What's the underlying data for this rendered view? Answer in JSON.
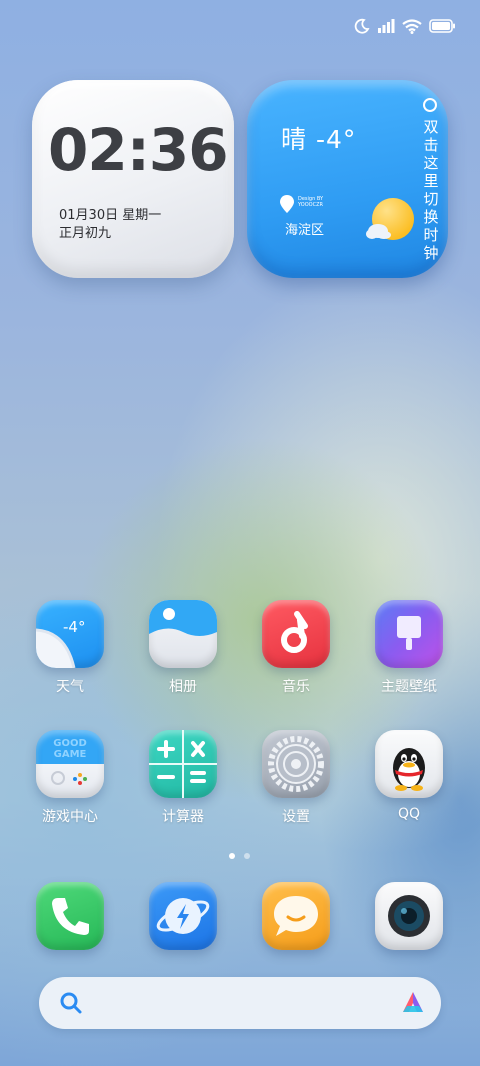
{
  "status_bar": {
    "icons": [
      "moon-icon",
      "signal-icon",
      "wifi-icon",
      "battery-icon"
    ]
  },
  "clock_widget": {
    "time": "02:36",
    "date": "01月30日 星期一",
    "lunar": "正月初九"
  },
  "weather_widget": {
    "condition": "晴 -4°",
    "design_credit": "Design BY YOOOCZR",
    "location": "海淀区",
    "switch_hint": "双击这里切换时钟"
  },
  "apps_row1": [
    {
      "label": "天气",
      "icon": "weather-app-icon",
      "temp": "-4°"
    },
    {
      "label": "相册",
      "icon": "gallery-app-icon"
    },
    {
      "label": "音乐",
      "icon": "music-app-icon"
    },
    {
      "label": "主题壁纸",
      "icon": "themes-app-icon"
    }
  ],
  "apps_row2": [
    {
      "label": "游戏中心",
      "icon": "game-center-app-icon",
      "badge": "GOOD GAME"
    },
    {
      "label": "计算器",
      "icon": "calculator-app-icon"
    },
    {
      "label": "设置",
      "icon": "settings-app-icon"
    },
    {
      "label": "QQ",
      "icon": "qq-app-icon"
    }
  ],
  "dock": [
    {
      "icon": "phone-app-icon"
    },
    {
      "icon": "browser-app-icon"
    },
    {
      "icon": "messages-app-icon"
    },
    {
      "icon": "camera-app-icon"
    }
  ],
  "pager": {
    "pages": 2,
    "current": 1
  },
  "search_bar": {
    "icons": [
      "search-icon",
      "assistant-icon"
    ]
  },
  "colors": {
    "weather_blue": "#2f9cf3",
    "music_red": "#f0424f",
    "theme_purple": "#8a5cf0",
    "calc_teal": "#2ec9b4"
  }
}
